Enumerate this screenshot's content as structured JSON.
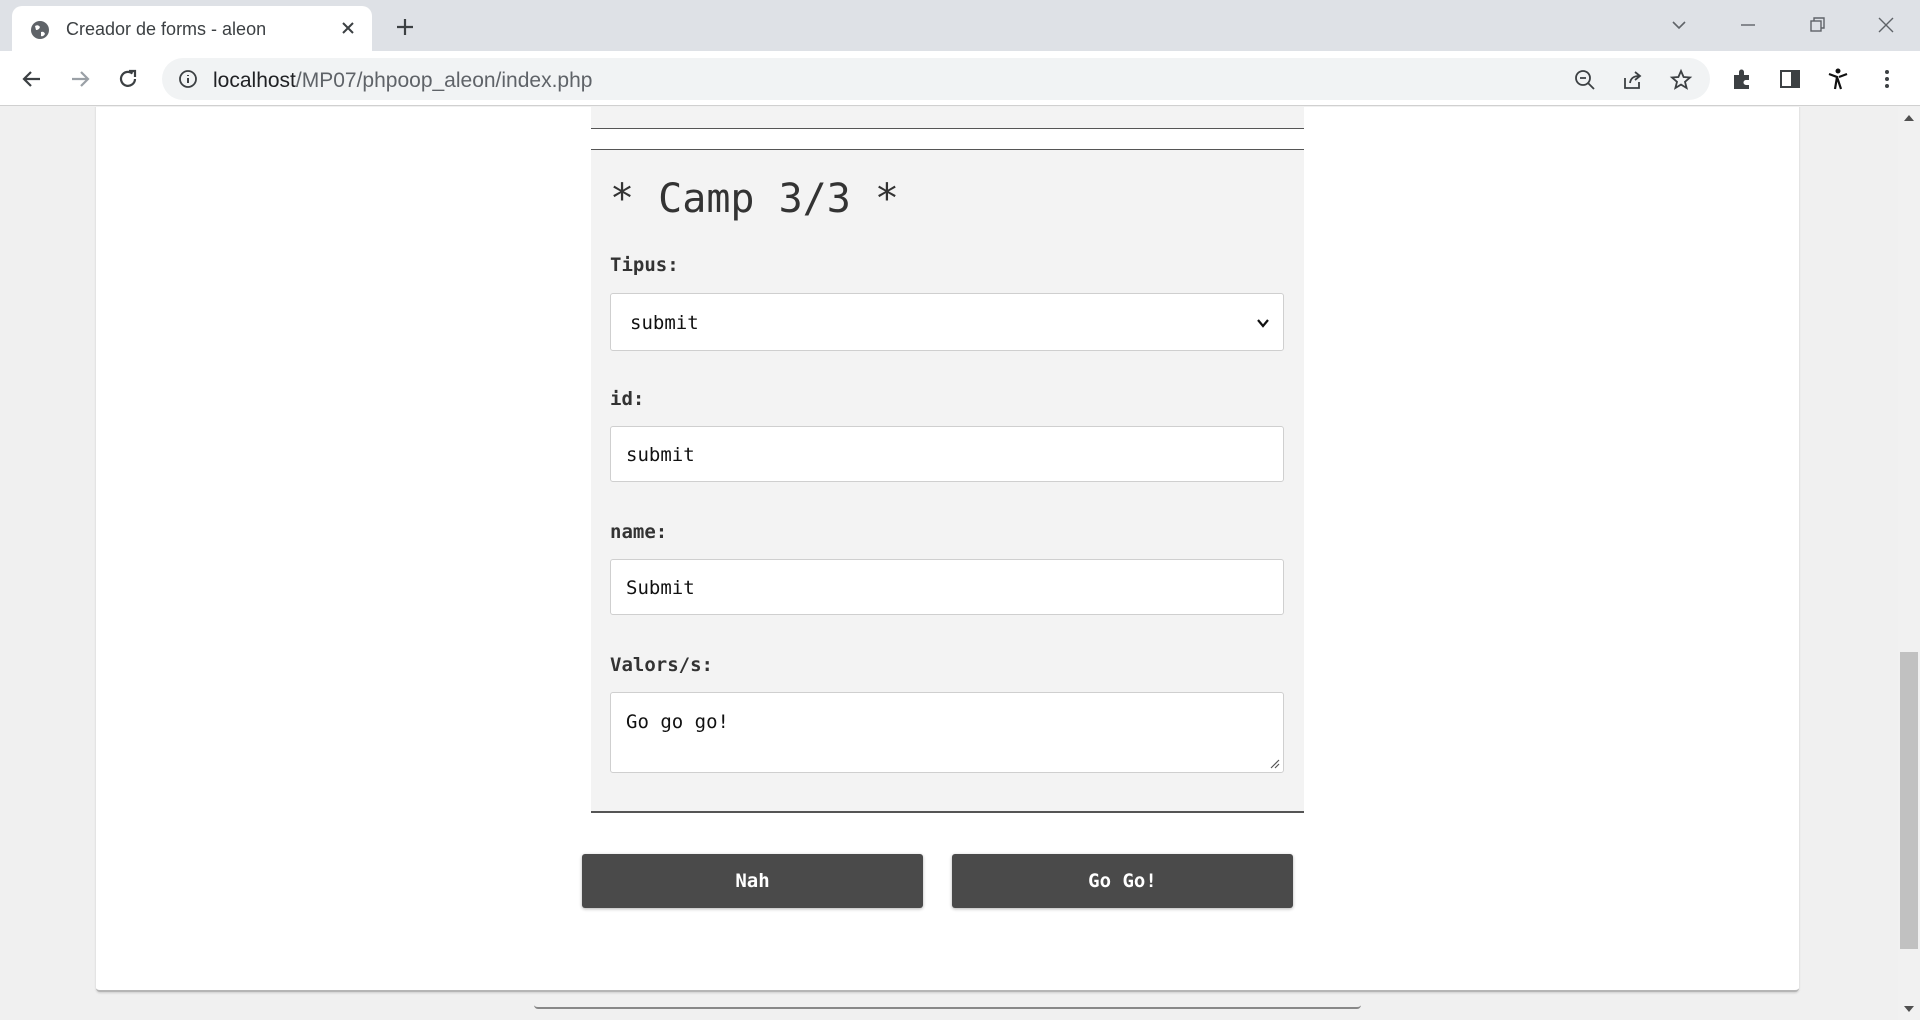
{
  "browser": {
    "tab_title": "Creador de forms - aleon",
    "url_host": "localhost",
    "url_path": "/MP07/phpoop_aleon/index.php"
  },
  "form": {
    "camp_title": "* Camp 3/3 *",
    "tipus_label": "Tipus:",
    "tipus_value": "submit",
    "id_label": "id:",
    "id_value": "submit",
    "name_label": "name:",
    "name_value": "Submit",
    "valors_label": "Valors/s:",
    "valors_value": "Go go go!",
    "cancel_button": "Nah",
    "submit_button": "Go Go!"
  },
  "colors": {
    "button_bg": "#4a4a4a",
    "fieldset_bg": "#f3f3f3",
    "tabstrip_bg": "#dee1e6"
  }
}
